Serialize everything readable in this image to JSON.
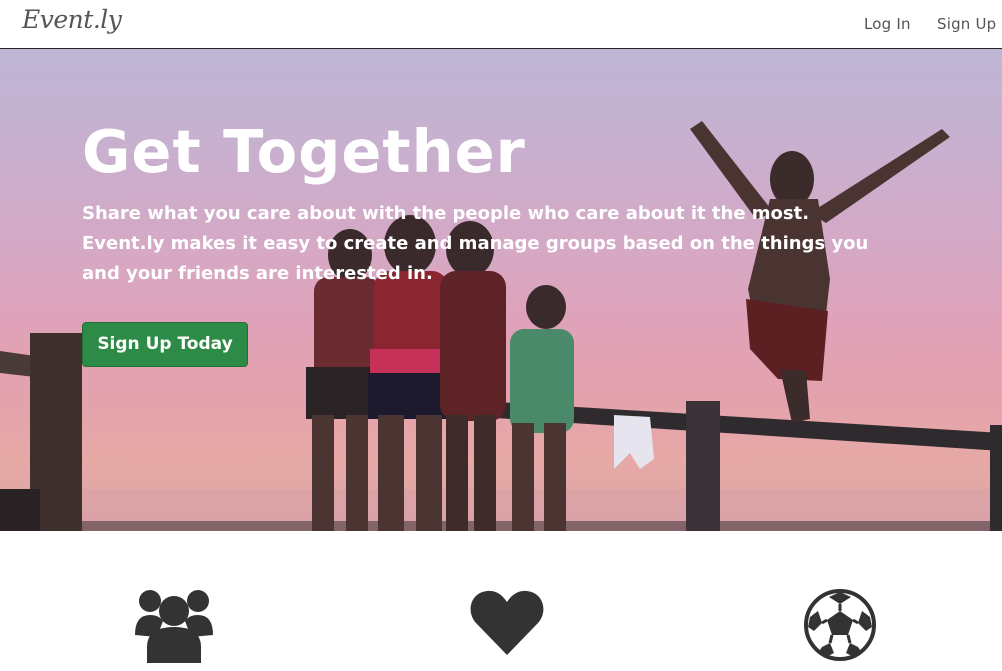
{
  "navbar": {
    "logo": "Event.ly",
    "login_label": "Log In",
    "signup_label": "Sign Up"
  },
  "hero": {
    "title": "Get Together",
    "description": "Share what you care about with the people who care about it the most. Event.ly makes it easy to create and manage groups based on the things you and your friends are interested in.",
    "cta_label": "Sign Up Today"
  },
  "features": {
    "icons": [
      "users-icon",
      "heart-icon",
      "soccer-ball-icon"
    ]
  },
  "colors": {
    "cta": "#2e8b47",
    "icon": "#333333",
    "nav_text": "#555555"
  }
}
